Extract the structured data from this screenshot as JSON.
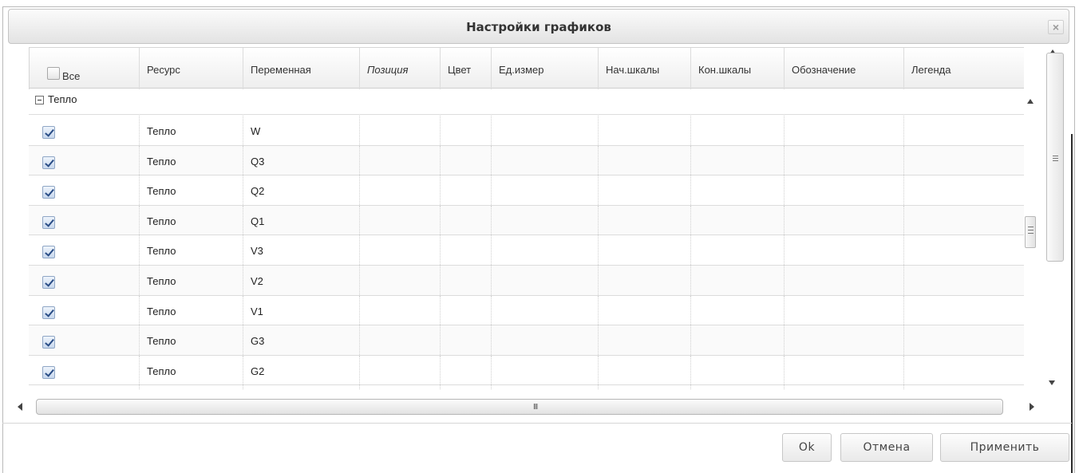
{
  "window": {
    "title": "Настройки графиков",
    "close_glyph": "×"
  },
  "grid": {
    "columns": [
      {
        "label": "Все",
        "italic": false
      },
      {
        "label": "Ресурс",
        "italic": false
      },
      {
        "label": "Переменная",
        "italic": false
      },
      {
        "label": "Позиция",
        "italic": true
      },
      {
        "label": "Цвет",
        "italic": false
      },
      {
        "label": "Ед.измер",
        "italic": false
      },
      {
        "label": "Нач.шкалы",
        "italic": false
      },
      {
        "label": "Кон.шкалы",
        "italic": false
      },
      {
        "label": "Обозначение",
        "italic": false
      },
      {
        "label": "Легенда",
        "italic": false
      }
    ],
    "select_all_checked": false,
    "group": {
      "label": "Тепло",
      "expanded": true
    },
    "rows": [
      {
        "checked": true,
        "resource": "Тепло",
        "variable": "W"
      },
      {
        "checked": true,
        "resource": "Тепло",
        "variable": "Q3"
      },
      {
        "checked": true,
        "resource": "Тепло",
        "variable": "Q2"
      },
      {
        "checked": true,
        "resource": "Тепло",
        "variable": "Q1"
      },
      {
        "checked": true,
        "resource": "Тепло",
        "variable": "V3"
      },
      {
        "checked": true,
        "resource": "Тепло",
        "variable": "V2"
      },
      {
        "checked": true,
        "resource": "Тепло",
        "variable": "V1"
      },
      {
        "checked": true,
        "resource": "Тепло",
        "variable": "G3"
      },
      {
        "checked": true,
        "resource": "Тепло",
        "variable": "G2"
      }
    ],
    "hscroll_grip": "III"
  },
  "buttons": {
    "ok": "Ok",
    "cancel": "Отмена",
    "apply": "Применить"
  },
  "icons": {
    "close": "close-icon",
    "collapse": "collapse-icon",
    "scroll_up": "arrow-up-icon",
    "scroll_down": "arrow-down-icon",
    "scroll_left": "arrow-left-icon",
    "scroll_right": "arrow-right-icon"
  }
}
